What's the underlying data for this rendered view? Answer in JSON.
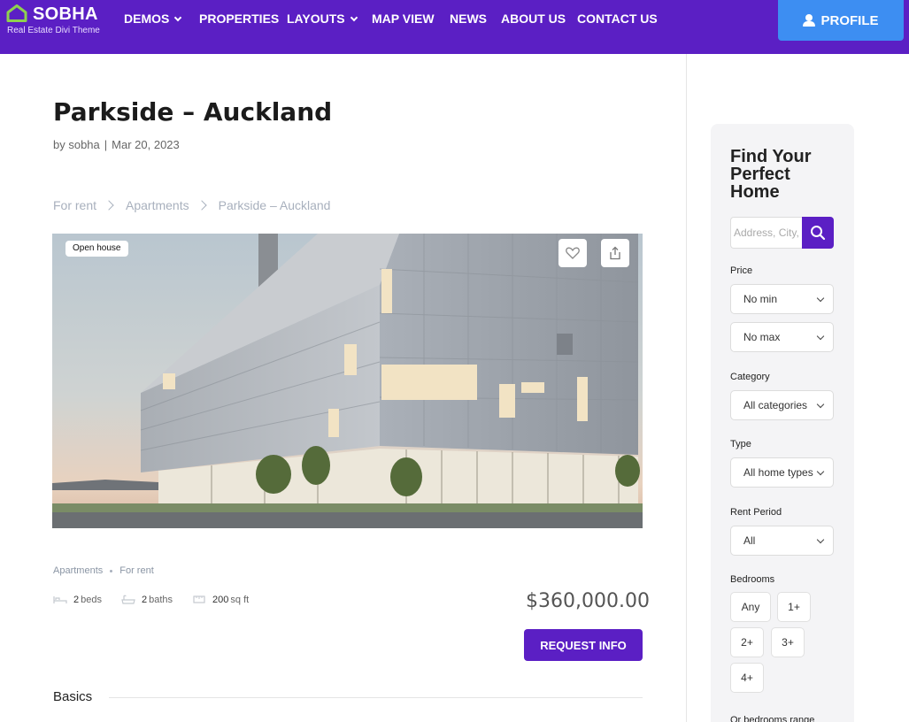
{
  "header": {
    "logo_name": "SOBHA",
    "logo_tagline": "Real Estate Divi Theme",
    "nav": [
      {
        "label": "DEMOS",
        "has_dropdown": true
      },
      {
        "label": "PROPERTIES",
        "has_dropdown": false
      },
      {
        "label": "LAYOUTS",
        "has_dropdown": true
      },
      {
        "label": "MAP VIEW",
        "has_dropdown": false
      },
      {
        "label": "NEWS",
        "has_dropdown": false
      },
      {
        "label": "ABOUT US",
        "has_dropdown": false
      },
      {
        "label": "CONTACT US",
        "has_dropdown": false
      }
    ],
    "profile_label": "PROFILE",
    "icons": {
      "profile": "user-icon",
      "logo": "house-outline-icon"
    }
  },
  "colors": {
    "brand_purple": "#5b1fc4",
    "profile_blue": "#3d8ef2",
    "breadcrumb_gray": "#a8b0bd",
    "sidebar_bg": "#f4f4f6"
  },
  "post": {
    "title": "Parkside – Auckland",
    "author": "by sobha",
    "date": "Mar 20, 2023",
    "meta_separator": "|"
  },
  "breadcrumb": [
    "For rent",
    "Apartments",
    "Parkside – Auckland"
  ],
  "gallery": {
    "badge": "Open house",
    "icons": [
      "heart-icon",
      "share-icon"
    ]
  },
  "listing": {
    "tags": [
      "Apartments",
      "For rent"
    ],
    "features": [
      {
        "icon": "bed-icon",
        "value": "2",
        "unit": "beds"
      },
      {
        "icon": "bath-icon",
        "value": "2",
        "unit": "baths"
      },
      {
        "icon": "area-icon",
        "value": "200",
        "unit": "sq ft"
      }
    ],
    "price": "$360,000.00",
    "request_label": "REQUEST INFO",
    "basics_title": "Basics"
  },
  "sidebar": {
    "title": "Find Your Perfect Home",
    "search_placeholder": "Address, City, ZIP...",
    "price_label": "Price",
    "price_min": "No min",
    "price_max": "No max",
    "category_label": "Category",
    "category_value": "All categories",
    "type_label": "Type",
    "type_value": "All home types",
    "rent_period_label": "Rent Period",
    "rent_period_value": "All",
    "bedrooms_label": "Bedrooms",
    "bedroom_options": [
      "Any",
      "1+",
      "2+",
      "3+",
      "4+"
    ],
    "footer_label": "Or bedrooms range"
  }
}
